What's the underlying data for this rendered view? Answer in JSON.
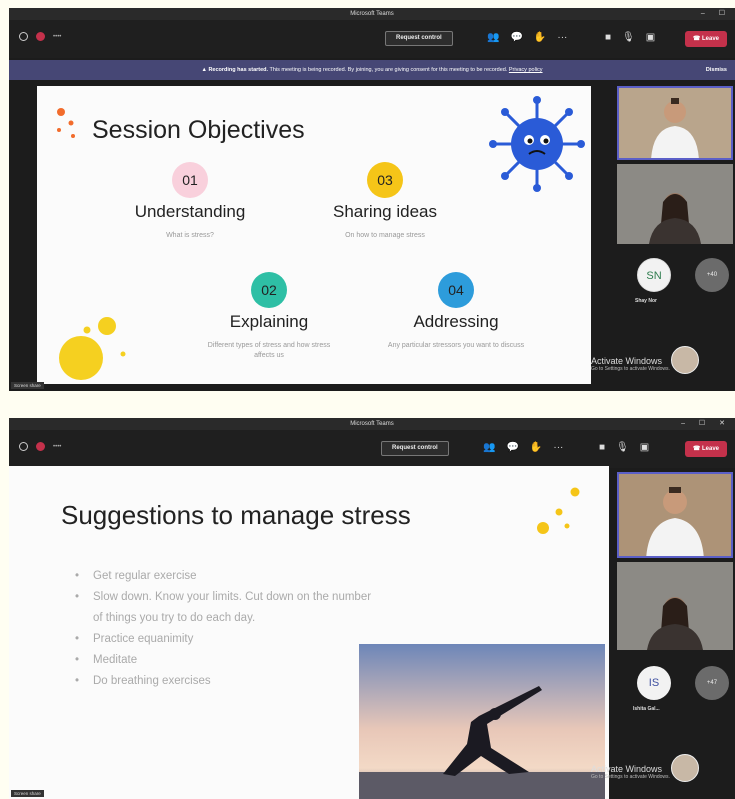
{
  "app_title": "Microsoft Teams",
  "toolbar": {
    "timer": "••••",
    "request_control": "Request control",
    "leave": "Leave"
  },
  "banner": {
    "title": "Recording has started.",
    "text": "This meeting is being recorded. By joining, you are giving consent for this meeting to be recorded.",
    "link": "Privacy policy",
    "dismiss": "Dismiss"
  },
  "slide1": {
    "title": "Session Objectives",
    "objectives": [
      {
        "num": "01",
        "title": "Understanding",
        "sub": "What is stress?",
        "color": "#f9c6d3"
      },
      {
        "num": "03",
        "title": "Sharing ideas",
        "sub": "On how to manage stress",
        "color": "#f5c518"
      },
      {
        "num": "02",
        "title": "Explaining",
        "sub": "Different types of stress and how stress affects us",
        "color": "#2ebfa5"
      },
      {
        "num": "04",
        "title": "Addressing",
        "sub": "Any particular stressors you want to discuss",
        "color": "#2d9cdb"
      }
    ]
  },
  "slide2": {
    "title": "Suggestions to manage stress",
    "bullets": [
      "Get regular exercise",
      "Slow down. Know your limits. Cut down on the number of things you try to do each day.",
      "Practice equanimity",
      "Meditate",
      "Do breathing exercises"
    ]
  },
  "participants1": [
    {
      "initials": "SN",
      "name": "Shay Nor"
    },
    {
      "initials": "+40"
    }
  ],
  "participants2": [
    {
      "initials": "IS",
      "name": "Ishita Gal..."
    },
    {
      "initials": "+47"
    }
  ],
  "watermark": {
    "title": "Activate Windows",
    "sub": "Go to Settings to activate Windows."
  },
  "sharer": "Screen share"
}
